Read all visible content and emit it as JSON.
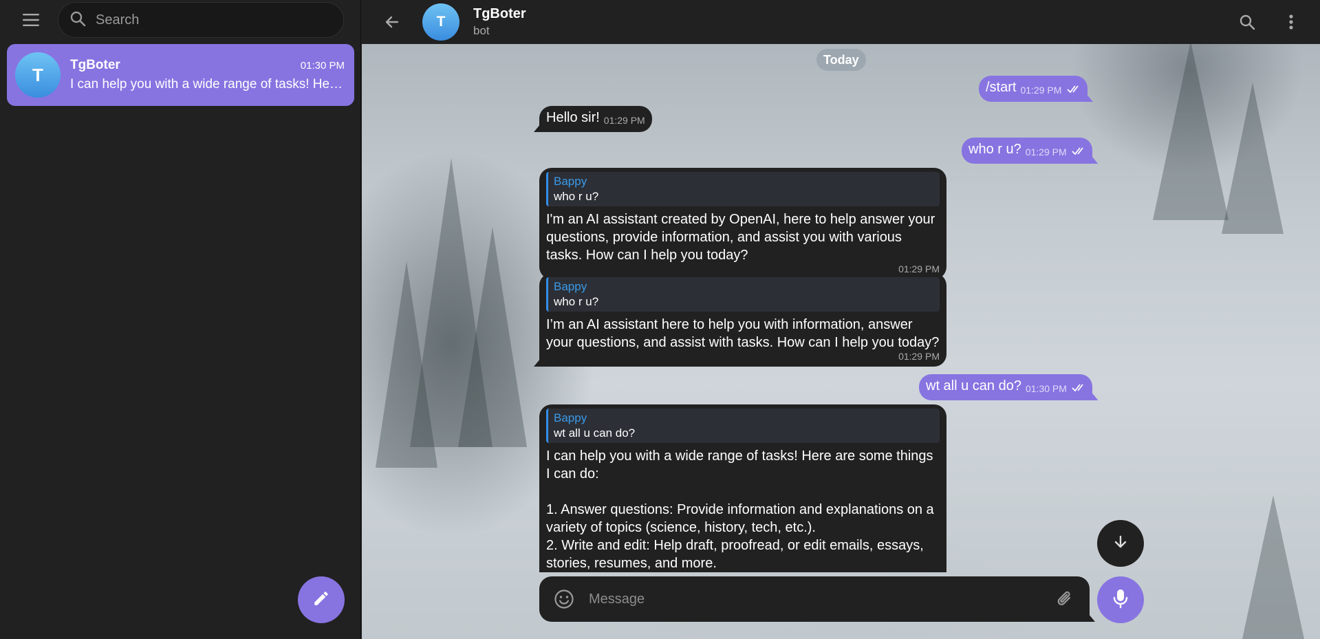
{
  "sidebar": {
    "search_placeholder": "Search",
    "chat": {
      "avatar_letter": "T",
      "name": "TgBoter",
      "time": "01:30 PM",
      "preview": "I can help you with a wide range of tasks! Here are some things I can do:"
    }
  },
  "header": {
    "avatar_letter": "T",
    "title": "TgBoter",
    "subtitle": "bot"
  },
  "date_separator": "Today",
  "messages": [
    {
      "text": "/start",
      "time": "01:29 PM"
    },
    {
      "text": "Hello sir!",
      "time": "01:29 PM"
    },
    {
      "text": "who r u?",
      "time": "01:29 PM"
    },
    {
      "reply_name": "Bappy",
      "reply_text": "who r u?",
      "text": "I'm an AI assistant created by OpenAI, here to help answer your questions, provide information, and assist you with various tasks. How can I help you today?",
      "time": "01:29 PM"
    },
    {
      "reply_name": "Bappy",
      "reply_text": "who r u?",
      "text": "I’m an AI assistant here to help you with information, answer your questions, and assist with tasks. How can I help you today?",
      "time": "01:29 PM"
    },
    {
      "text": "wt all u can do?",
      "time": "01:30 PM"
    },
    {
      "reply_name": "Bappy",
      "reply_text": "wt all u can do?",
      "text": "I can help you with a wide range of tasks! Here are some things I can do:\n\n1. Answer questions: Provide information and explanations on a variety of topics (science, history, tech, etc.).\n2. Write and edit: Help draft, proofread, or edit emails, essays, stories, resumes, and more."
    }
  ],
  "composer": {
    "placeholder": "Message"
  },
  "colors": {
    "accent": "#8774e1",
    "panel": "#212121",
    "quote_link": "#3a9be9"
  }
}
